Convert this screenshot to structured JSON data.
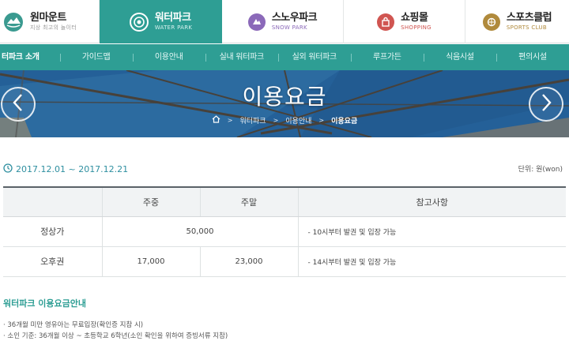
{
  "top_nav": {
    "brand": {
      "name": "원마운트",
      "tagline": "지상 최고의 놀이터",
      "icon": "one-mount-logo-icon"
    },
    "tabs": [
      {
        "name": "워터파크",
        "sub": "WATER PARK",
        "icon": "water-park-icon",
        "active": true
      },
      {
        "name": "스노우파크",
        "sub": "SNOW PARK",
        "icon": "snow-park-icon",
        "active": false
      },
      {
        "name": "쇼핑몰",
        "sub": "SHOPPING",
        "icon": "shopping-icon",
        "active": false
      },
      {
        "name": "스포츠클럽",
        "sub": "SPORTS CLUB",
        "icon": "sports-club-icon",
        "active": false
      }
    ]
  },
  "sub_nav": {
    "items": [
      "터파크 소개",
      "가이드맵",
      "이용안내",
      "실내 워터파크",
      "실외 워터파크",
      "루프가든",
      "식음시설",
      "편의시설"
    ]
  },
  "hero": {
    "title": "이용요금",
    "breadcrumb": [
      "워터파크",
      "이용안내",
      "이용요금"
    ],
    "home_icon": "home-icon",
    "prev_icon": "chevron-left-icon",
    "next_icon": "chevron-right-icon"
  },
  "period": {
    "text": "2017.12.01 ~ 2017.12.21",
    "icon": "clock-icon"
  },
  "unit": "단위: 원(won)",
  "table": {
    "headers": [
      "",
      "주중",
      "주말",
      "참고사항"
    ],
    "rows": [
      {
        "label": "정상가",
        "weekday": "50,000",
        "weekend": "",
        "note": "- 10시부터 발권 및 입장 가능"
      },
      {
        "label": "오후권",
        "weekday": "17,000",
        "weekend": "23,000",
        "note": "- 14시부터 발권 및 입장 가능"
      }
    ]
  },
  "notice": {
    "title": "워터파크 이용요금안내",
    "lines": [
      "· 36개월 미만 영유아는 무료입장(확인증 지참 시)",
      "· 소인 기준: 36개월 이상 ~ 초등학교 6학년(소인 확인을 위하여 증빙서류 지참)"
    ]
  },
  "colors": {
    "accent": "#2e9e94",
    "snow": "#8b69b9",
    "shop": "#d05551",
    "sports": "#b08a3c",
    "date": "#2e8fa0"
  }
}
